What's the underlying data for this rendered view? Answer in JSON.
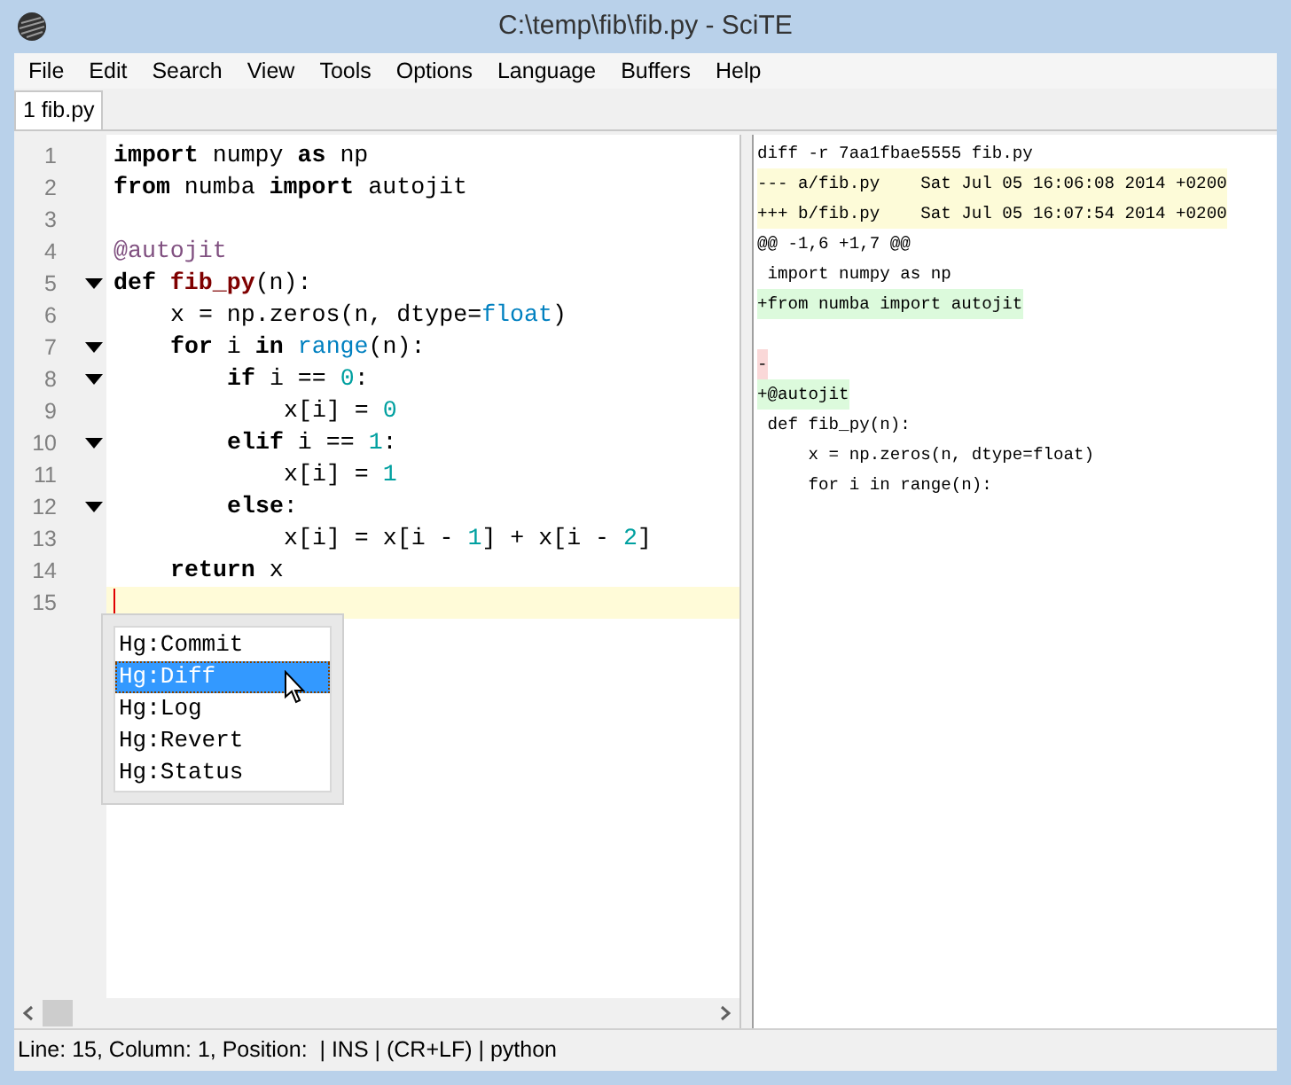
{
  "window": {
    "title": "C:\\temp\\fib\\fib.py - SciTE"
  },
  "menu": [
    "File",
    "Edit",
    "Search",
    "View",
    "Tools",
    "Options",
    "Language",
    "Buffers",
    "Help"
  ],
  "tabs": [
    {
      "label": "1 fib.py",
      "selected": true
    }
  ],
  "editor": {
    "lines": [
      {
        "number": "1",
        "fold": false,
        "current": false,
        "tokens": [
          {
            "kind": "kw",
            "text": "import"
          },
          {
            "kind": "plain",
            "text": " numpy "
          },
          {
            "kind": "kw",
            "text": "as"
          },
          {
            "kind": "plain",
            "text": " np"
          }
        ]
      },
      {
        "number": "2",
        "fold": false,
        "current": false,
        "tokens": [
          {
            "kind": "kw",
            "text": "from"
          },
          {
            "kind": "plain",
            "text": " numba "
          },
          {
            "kind": "kw",
            "text": "import"
          },
          {
            "kind": "plain",
            "text": " autojit"
          }
        ]
      },
      {
        "number": "3",
        "fold": false,
        "current": false
      },
      {
        "number": "4",
        "fold": false,
        "current": false,
        "tokens": [
          {
            "kind": "deco",
            "text": "@autojit"
          }
        ]
      },
      {
        "number": "5",
        "fold": true,
        "current": false,
        "tokens": [
          {
            "kind": "kw",
            "text": "def "
          },
          {
            "kind": "fn",
            "text": "fib_py"
          },
          {
            "kind": "plain",
            "text": "(n):"
          }
        ]
      },
      {
        "number": "6",
        "fold": false,
        "current": false,
        "tokens": [
          {
            "kind": "indent"
          },
          {
            "kind": "plain",
            "text": "x = np.zeros(n, dtype="
          },
          {
            "kind": "builtin",
            "text": "float"
          },
          {
            "kind": "plain",
            "text": ")"
          }
        ]
      },
      {
        "number": "7",
        "fold": true,
        "current": false,
        "tokens": [
          {
            "kind": "indent"
          },
          {
            "kind": "kw",
            "text": "for"
          },
          {
            "kind": "plain",
            "text": " i "
          },
          {
            "kind": "kw",
            "text": "in"
          },
          {
            "kind": "builtin",
            "text": " range"
          },
          {
            "kind": "plain",
            "text": "(n):"
          }
        ]
      },
      {
        "number": "8",
        "fold": true,
        "current": false,
        "tokens": [
          {
            "kind": "indent"
          },
          {
            "kind": "indent"
          },
          {
            "kind": "kw",
            "text": "if"
          },
          {
            "kind": "plain",
            "text": " i == "
          },
          {
            "kind": "num",
            "text": "0"
          },
          {
            "kind": "plain",
            "text": ":"
          }
        ]
      },
      {
        "number": "9",
        "fold": false,
        "current": false,
        "tokens": [
          {
            "kind": "indent"
          },
          {
            "kind": "indent"
          },
          {
            "kind": "indent"
          },
          {
            "kind": "plain",
            "text": "x[i] = "
          },
          {
            "kind": "num",
            "text": "0"
          }
        ]
      },
      {
        "number": "10",
        "fold": true,
        "current": false,
        "tokens": [
          {
            "kind": "indent"
          },
          {
            "kind": "indent"
          },
          {
            "kind": "kw",
            "text": "elif"
          },
          {
            "kind": "plain",
            "text": " i == "
          },
          {
            "kind": "num",
            "text": "1"
          },
          {
            "kind": "plain",
            "text": ":"
          }
        ]
      },
      {
        "number": "11",
        "fold": false,
        "current": false,
        "tokens": [
          {
            "kind": "indent"
          },
          {
            "kind": "indent"
          },
          {
            "kind": "indent"
          },
          {
            "kind": "plain",
            "text": "x[i] = "
          },
          {
            "kind": "num",
            "text": "1"
          }
        ]
      },
      {
        "number": "12",
        "fold": true,
        "current": false,
        "tokens": [
          {
            "kind": "indent"
          },
          {
            "kind": "indent"
          },
          {
            "kind": "kw",
            "text": "else"
          },
          {
            "kind": "plain",
            "text": ":"
          }
        ]
      },
      {
        "number": "13",
        "fold": false,
        "current": false,
        "tokens": [
          {
            "kind": "indent"
          },
          {
            "kind": "indent"
          },
          {
            "kind": "indent"
          },
          {
            "kind": "plain",
            "text": "x[i] = x[i - "
          },
          {
            "kind": "num",
            "text": "1"
          },
          {
            "kind": "plain",
            "text": "] + x[i - "
          },
          {
            "kind": "num",
            "text": "2"
          },
          {
            "kind": "plain",
            "text": "]"
          }
        ]
      },
      {
        "number": "14",
        "fold": false,
        "current": false,
        "tokens": [
          {
            "kind": "indent"
          },
          {
            "kind": "kw",
            "text": "return"
          },
          {
            "kind": "plain",
            "text": " x"
          }
        ]
      },
      {
        "number": "15",
        "fold": false,
        "current": true
      }
    ]
  },
  "autocomplete": [
    {
      "label": "Hg:Commit",
      "selected": false
    },
    {
      "label": "Hg:Diff",
      "selected": true
    },
    {
      "label": "Hg:Log",
      "selected": false
    },
    {
      "label": "Hg:Revert",
      "selected": false
    },
    {
      "label": "Hg:Status",
      "selected": false
    }
  ],
  "output": {
    "lines": [
      {
        "kind": "header",
        "text": "diff -r 7aa1fbae5555 fib.py"
      },
      {
        "kind": "file",
        "text": "--- a/fib.py    Sat Jul 05 16:06:08 2014 +0200"
      },
      {
        "kind": "file",
        "text": "+++ b/fib.py    Sat Jul 05 16:07:54 2014 +0200"
      },
      {
        "kind": "hunk",
        "text": "@@ -1,6 +1,7 @@"
      },
      {
        "kind": "context",
        "text": " import numpy as np"
      },
      {
        "kind": "add",
        "text": "+from numba import autojit"
      },
      {
        "kind": "blank"
      },
      {
        "kind": "del",
        "text": "-"
      },
      {
        "kind": "add",
        "text": "+@autojit"
      },
      {
        "kind": "context",
        "text": " def fib_py(n):"
      },
      {
        "kind": "context",
        "text": "     x = np.zeros(n, dtype=float)"
      },
      {
        "kind": "context",
        "text": "     for i in range(n):"
      }
    ]
  },
  "status_bar": "Line: 15, Column: 1, Position:  | INS | (CR+LF) | python"
}
